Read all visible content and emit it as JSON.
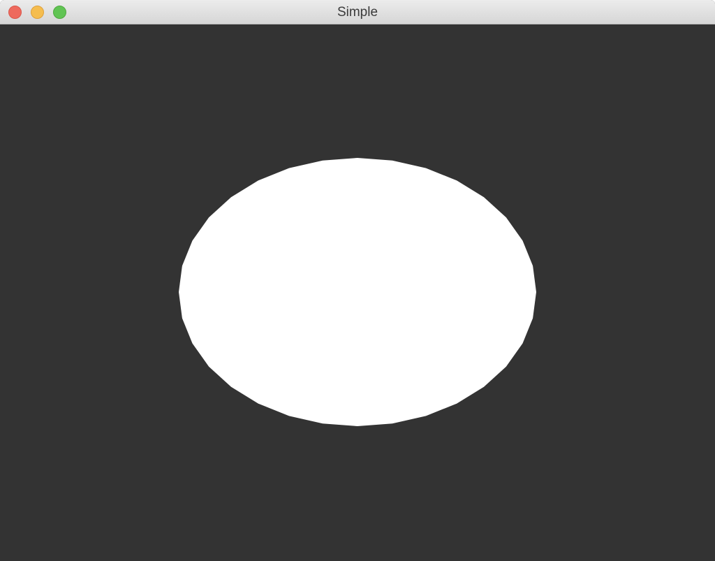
{
  "window": {
    "title": "Simple",
    "controls": {
      "close": "close-icon",
      "minimize": "minimize-icon",
      "zoom": "zoom-icon"
    }
  },
  "canvas": {
    "background_color": "#333333",
    "shape": {
      "type": "ellipse",
      "fill_color": "#ffffff"
    }
  }
}
